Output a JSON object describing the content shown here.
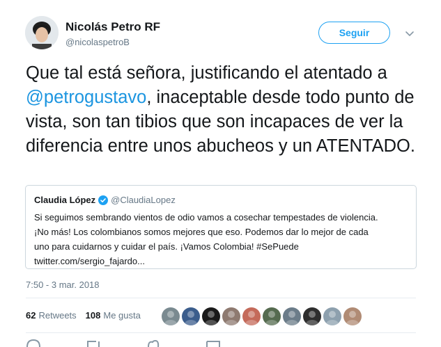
{
  "author": {
    "name": "Nicolás Petro RF",
    "handle": "@nicolaspetroB"
  },
  "follow_label": "Seguir",
  "tweet": {
    "part1": "Que tal está señora, justificando el atentado a ",
    "mention": "@petrogustavo",
    "part2": ", inaceptable desde todo punto de vista, son tan tibios que son incapaces de ver la diferencia entre unos abucheos y un ATENTADO."
  },
  "quoted": {
    "name": "Claudia López",
    "handle": "@ClaudiaLopez",
    "lines": [
      "Si seguimos sembrando vientos de odio vamos a cosechar tempestades de violencia.",
      "¡No más! Los colombianos somos mejores que eso. Podemos dar lo mejor de cada",
      "uno para cuidarnos y cuidar el país. ¡Vamos Colombia! #SePuede",
      "twitter.com/sergio_fajardo..."
    ]
  },
  "timestamp": "7:50 - 3 mar. 2018",
  "stats": {
    "retweets_count": "62",
    "retweets_label": "Retweets",
    "likes_count": "108",
    "likes_label": "Me gusta"
  },
  "liker_colors": [
    "#7a8a90",
    "#3b5d8c",
    "#1a1a1a",
    "#8e7a70",
    "#c46a5a",
    "#556b4f",
    "#6b7c89",
    "#2e2e2e",
    "#8da0ae",
    "#b08b74"
  ],
  "colors": {
    "accent": "#1da1f2",
    "mention": "#1b95e0",
    "muted": "#657786"
  }
}
